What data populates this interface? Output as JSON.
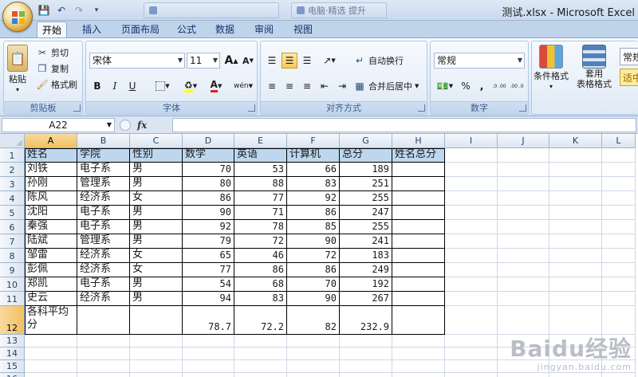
{
  "window": {
    "title": "测试.xlsx - Microsoft Excel",
    "browser_tabs": [
      " ",
      "电脑·精选 提升"
    ]
  },
  "ribbon_tabs": [
    "开始",
    "插入",
    "页面布局",
    "公式",
    "数据",
    "审阅",
    "视图"
  ],
  "clipboard": {
    "paste": "粘贴",
    "cut": "剪切",
    "copy": "复制",
    "format_painter": "格式刷",
    "label": "剪贴板"
  },
  "font": {
    "name": "宋体",
    "size": "11",
    "grow": "A",
    "shrink": "A",
    "bold": "B",
    "italic": "I",
    "underline": "U",
    "font_color": "A",
    "phonetic": "wén",
    "label": "字体"
  },
  "alignment": {
    "wrap_text": "自动换行",
    "merge_center": "合并后居中",
    "label": "对齐方式"
  },
  "number": {
    "format": "常规",
    "percent": "%",
    "comma": ",",
    "inc_decimal": ".0 .00",
    "dec_decimal": ".00 .0",
    "label": "数字"
  },
  "styles": {
    "conditional": "条件格式",
    "table_format_1": "套用",
    "table_format_2": "表格格式",
    "cell_style_1": "常规",
    "cell_style_2": "适中"
  },
  "formula_bar": {
    "name_box": "A22",
    "fx": "fx",
    "content": ""
  },
  "grid": {
    "columns": [
      "A",
      "B",
      "C",
      "D",
      "E",
      "F",
      "G",
      "H",
      "I",
      "J",
      "K",
      "L"
    ],
    "selected_column": "A",
    "selected_row": "12",
    "rows": [
      "1",
      "2",
      "3",
      "4",
      "5",
      "6",
      "7",
      "8",
      "9",
      "10",
      "11",
      "12",
      "13",
      "14",
      "15",
      "16"
    ],
    "headers": [
      "姓名",
      "学院",
      "性别",
      "数学",
      "英语",
      "计算机",
      "总分",
      "姓名总分"
    ],
    "records": [
      [
        "刘铁",
        "电子系",
        "男",
        "70",
        "53",
        "66",
        "189",
        ""
      ],
      [
        "孙刚",
        "管理系",
        "男",
        "80",
        "88",
        "83",
        "251",
        ""
      ],
      [
        "陈风",
        "经济系",
        "女",
        "86",
        "77",
        "92",
        "255",
        ""
      ],
      [
        "沈阳",
        "电子系",
        "男",
        "90",
        "71",
        "86",
        "247",
        ""
      ],
      [
        "秦强",
        "电子系",
        "男",
        "92",
        "78",
        "85",
        "255",
        ""
      ],
      [
        "陆斌",
        "管理系",
        "男",
        "79",
        "72",
        "90",
        "241",
        ""
      ],
      [
        "邹雷",
        "经济系",
        "女",
        "65",
        "46",
        "72",
        "183",
        ""
      ],
      [
        "彭佩",
        "经济系",
        "女",
        "77",
        "86",
        "86",
        "249",
        ""
      ],
      [
        "郑凯",
        "电子系",
        "男",
        "54",
        "68",
        "70",
        "192",
        ""
      ],
      [
        "史云",
        "经济系",
        "男",
        "94",
        "83",
        "90",
        "267",
        ""
      ]
    ],
    "average_row": [
      "各科平均分",
      "",
      "",
      "78.7",
      "72.2",
      "82",
      "232.9",
      ""
    ]
  },
  "watermark": {
    "main": "Baidu经验",
    "sub": "jingyan.baidu.com"
  }
}
